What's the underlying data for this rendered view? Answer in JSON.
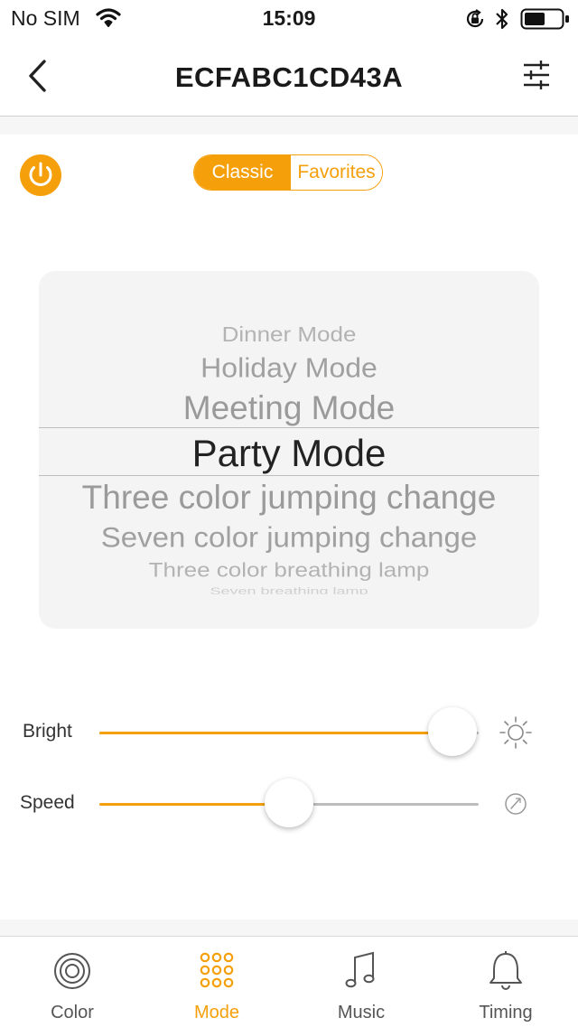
{
  "status_bar": {
    "carrier": "No SIM",
    "time": "15:09"
  },
  "nav": {
    "title": "ECFABC1CD43A"
  },
  "segment": {
    "classic_label": "Classic",
    "favorites_label": "Favorites",
    "selected": "Classic"
  },
  "picker": {
    "items": [
      "Dinner Mode",
      "Holiday Mode",
      "Meeting Mode",
      "Party Mode",
      "Three color jumping change",
      "Seven color jumping change",
      "Three color breathing lamp",
      "Seven breathing lamp"
    ],
    "selected_index": 3
  },
  "sliders": {
    "bright": {
      "label": "Bright",
      "value": 0.93
    },
    "speed": {
      "label": "Speed",
      "value": 0.5
    }
  },
  "tabs": [
    {
      "label": "Color",
      "icon": "color-rings-icon",
      "active": false
    },
    {
      "label": "Mode",
      "icon": "mode-grid-icon",
      "active": true
    },
    {
      "label": "Music",
      "icon": "music-note-icon",
      "active": false
    },
    {
      "label": "Timing",
      "icon": "bell-icon",
      "active": false
    }
  ],
  "colors": {
    "accent": "#f5a00b",
    "track_inactive": "#bdbdbd"
  }
}
